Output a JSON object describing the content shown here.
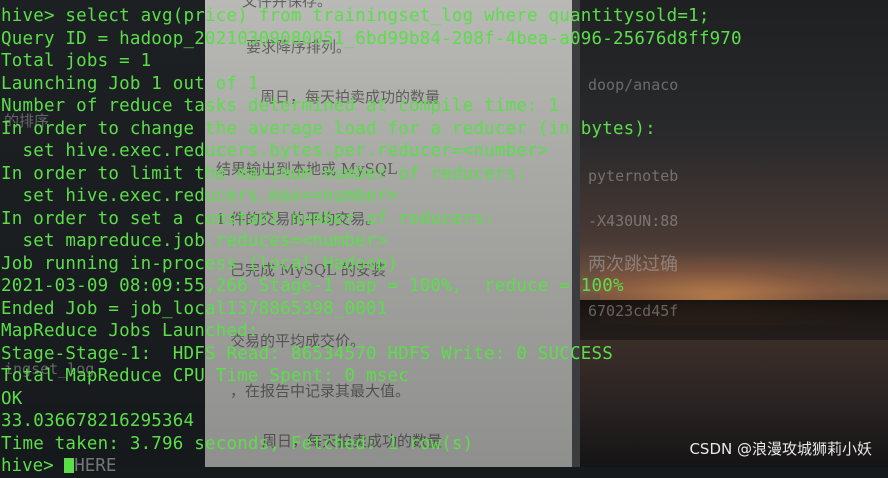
{
  "terminal": {
    "lines": [
      "hive> select avg(price) from trainingset_log where quantitysold=1;",
      "Query ID = hadoop_20210309080951_6bd99b84-208f-4bea-a096-25676d8ff970",
      "Total jobs = 1",
      "Launching Job 1 out of 1",
      "Number of reduce tasks determined at compile time: 1",
      "In order to change the average load for a reducer (in bytes):",
      "  set hive.exec.reducers.bytes.per.reducer=<number>",
      "In order to limit the maximum number of reducers:",
      "  set hive.exec.reducers.max=<number>",
      "In order to set a constant number of reducers:",
      "  set mapreduce.job.reduces=<number>",
      "Job running in-process (local Hadoop)",
      "2021-03-09 08:09:55,266 Stage-1 map = 100%,  reduce = 100%",
      "Ended Job = job_local1378865398_0001",
      "MapReduce Jobs Launched:",
      "Stage-Stage-1:  HDFS Read: 86534570 HDFS Write: 0 SUCCESS",
      "Total MapReduce CPU Time Spent: 0 msec",
      "OK",
      "33.036678216295364",
      "Time taken: 3.796 seconds, Fetched: 1 row(s)"
    ],
    "prompt": "hive> ",
    "after_cursor": "HERE"
  },
  "background_text": {
    "doc": [
      "文件并保存。",
      "要求降序排列。",
      "周日，每天拍卖成功的数量",
      "结果输出到本地或 MySQL",
      "1 件的交易的平均交易。",
      "已完成 MySQL 的安装",
      "交易的平均成交价。",
      "，在报告中记录其最大值。",
      "周日，每天拍卖成功的数量"
    ],
    "left": [
      "的排序",
      "ingset_log"
    ],
    "right": [
      "doop/anaco",
      "pyternoteb",
      "-X430UN:88",
      "两次跳过确",
      "67023cd45f"
    ]
  },
  "watermark": "CSDN @浪漫攻城狮莉小妖",
  "colors": {
    "terminal_text": "#5bde4a",
    "watermark": "#e9e9e9"
  }
}
